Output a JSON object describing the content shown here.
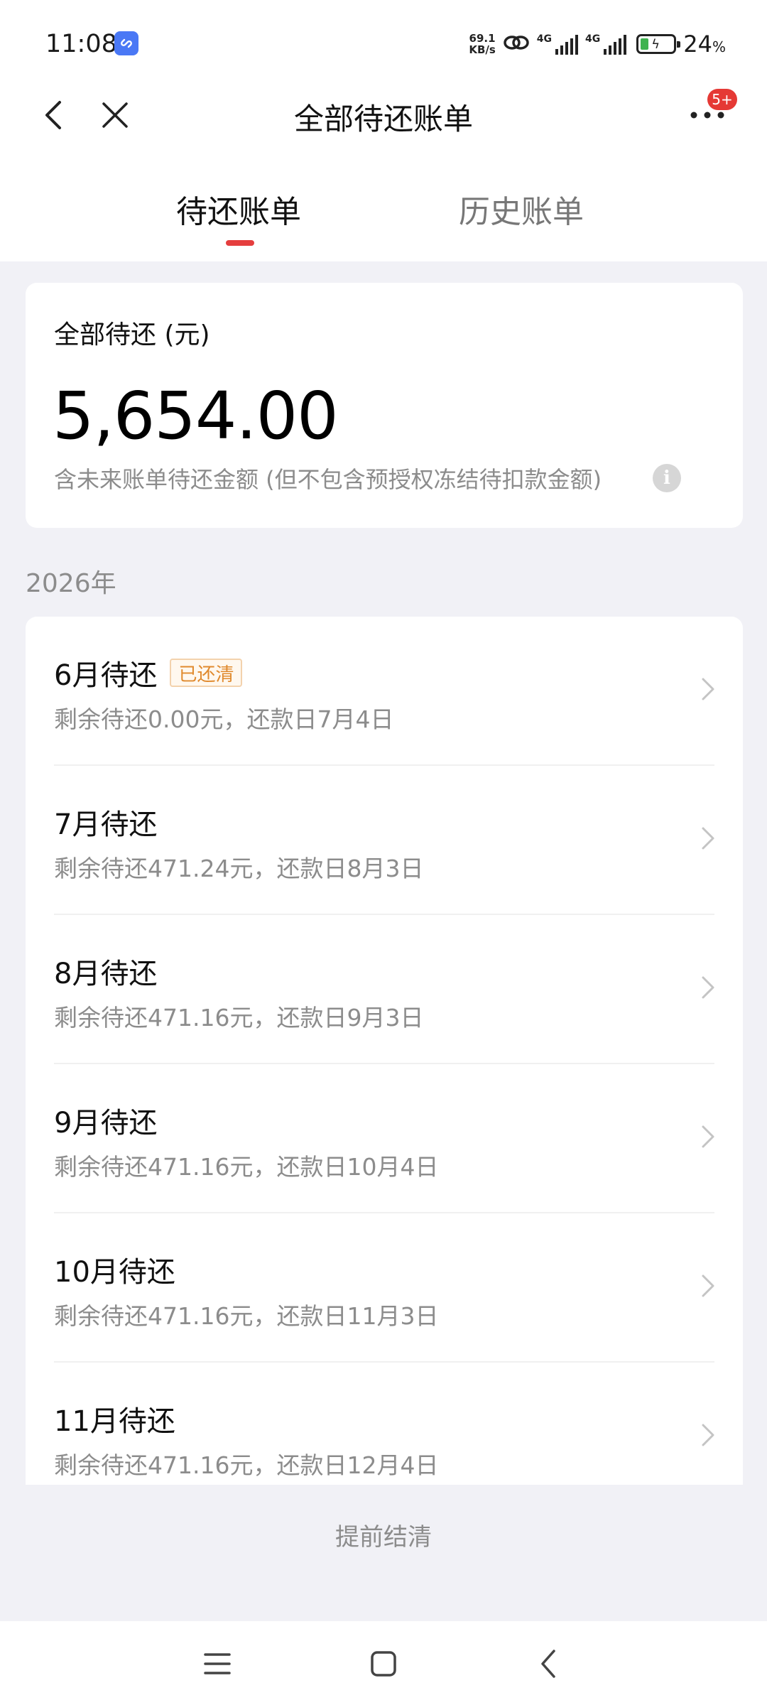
{
  "status_bar": {
    "time": "11:08",
    "net_speed_value": "69.1",
    "net_speed_unit": "KB/s",
    "signal1_label": "4G",
    "signal2_label": "4G",
    "battery_percent": "24",
    "battery_percent_sign": "%",
    "battery_fill_fraction": 0.24,
    "icons": [
      "app-link-icon",
      "hotspot-link-icon",
      "signal-icon",
      "signal-icon",
      "battery-charging-icon"
    ]
  },
  "header": {
    "title": "全部待还账单",
    "more_badge": "5+",
    "icons": [
      "back-arrow-icon",
      "close-icon",
      "more-dots-icon"
    ]
  },
  "tabs": [
    {
      "label": "待还账单",
      "active": true
    },
    {
      "label": "历史账单",
      "active": false
    }
  ],
  "summary": {
    "label": "全部待还 (元)",
    "amount": "5,654.00",
    "note": "含未来账单待还金额 (但不包含预授权冻结待扣款金额)",
    "info_icon_glyph": "i"
  },
  "year_label": "2026年",
  "bills": [
    {
      "title": "6月待还",
      "tag": "已还清",
      "subtitle": "剩余待还0.00元，还款日7月4日"
    },
    {
      "title": "7月待还",
      "tag": "",
      "subtitle": "剩余待还471.24元，还款日8月3日"
    },
    {
      "title": "8月待还",
      "tag": "",
      "subtitle": "剩余待还471.16元，还款日9月3日"
    },
    {
      "title": "9月待还",
      "tag": "",
      "subtitle": "剩余待还471.16元，还款日10月4日"
    },
    {
      "title": "10月待还",
      "tag": "",
      "subtitle": "剩余待还471.16元，还款日11月3日"
    },
    {
      "title": "11月待还",
      "tag": "",
      "subtitle": "剩余待还471.16元，还款日12月4日"
    }
  ],
  "payoff_label": "提前结清",
  "colors": {
    "accent_red": "#e53e3e",
    "tag_orange": "#e08a2e",
    "background": "#f1f1f6",
    "muted_text": "#8c8c8c"
  },
  "system_nav": {
    "icons": [
      "menu-icon",
      "home-square-icon",
      "back-chevron-icon"
    ]
  }
}
